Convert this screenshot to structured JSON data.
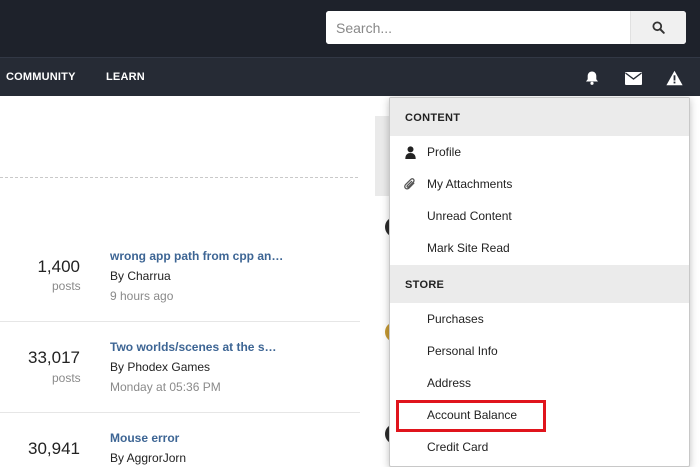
{
  "header": {
    "search": {
      "placeholder": "Search...",
      "value": ""
    },
    "icons": {
      "search": "search-icon"
    }
  },
  "nav": {
    "links": [
      "COMMUNITY",
      "LEARN"
    ],
    "icons": [
      "bell-icon",
      "envelope-icon",
      "warning-icon"
    ]
  },
  "topics": [
    {
      "count": "1,400",
      "count_label": "posts",
      "title": "wrong app path from cpp an…",
      "by": "By Charrua",
      "time": "9 hours ago"
    },
    {
      "count": "33,017",
      "count_label": "posts",
      "title": "Two worlds/scenes at the s…",
      "by": "By Phodex Games",
      "time": "Monday at 05:36 PM"
    },
    {
      "count": "30,941",
      "count_label": "",
      "title": "Mouse error",
      "by": "By AggrorJorn",
      "time": ""
    }
  ],
  "dropdown": {
    "content_header": "CONTENT",
    "content_items": [
      {
        "label": "Profile",
        "icon": "user-icon"
      },
      {
        "label": "My Attachments",
        "icon": "paperclip-icon"
      },
      {
        "label": "Unread Content",
        "icon": ""
      },
      {
        "label": "Mark Site Read",
        "icon": ""
      }
    ],
    "store_header": "STORE",
    "store_items": [
      {
        "label": "Purchases"
      },
      {
        "label": "Personal Info"
      },
      {
        "label": "Address"
      },
      {
        "label": "Account Balance"
      },
      {
        "label": "Credit Card"
      }
    ],
    "highlighted": "Account Balance",
    "highlight_color": "#e0141c"
  },
  "colors": {
    "topbar": "#1e222b",
    "navbar": "#262b35",
    "link": "#3d6594"
  }
}
